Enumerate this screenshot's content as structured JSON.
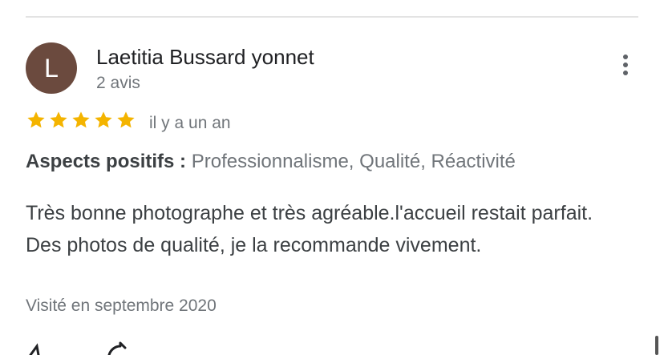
{
  "review": {
    "avatar_initial": "L",
    "reviewer_name": "Laetitia Bussard yonnet",
    "review_count": "2 avis",
    "rating": 5,
    "rating_max": 5,
    "date": "il y a un an",
    "aspects_label": "Aspects positifs :",
    "aspects_values": "Professionnalisme, Qualité, Réactivité",
    "text": "Très bonne photographe et très agréable.l'accueil restait parfait. Des photos de qualité, je la recommande vivement.",
    "visited": "Visité en septembre 2020"
  },
  "icons": {
    "more": "more-vert-icon",
    "star": "star-icon",
    "like": "thumb-up-icon",
    "share": "share-icon"
  },
  "colors": {
    "avatar_bg": "#6b4a3e",
    "star": "#f4b400",
    "secondary_text": "#70757a",
    "divider": "#e3e3e3"
  }
}
